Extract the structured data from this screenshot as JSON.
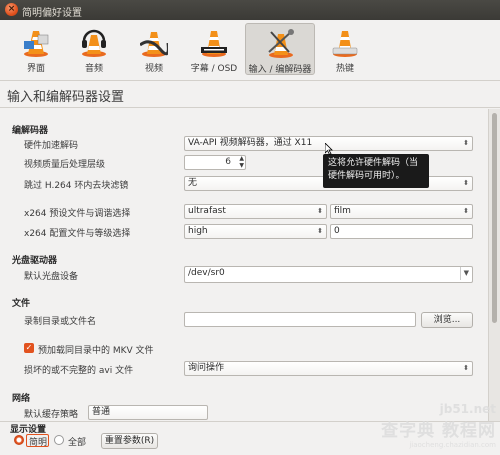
{
  "window": {
    "title": "简明偏好设置"
  },
  "toolbar": {
    "items": [
      {
        "label": "界面"
      },
      {
        "label": "音频"
      },
      {
        "label": "视频"
      },
      {
        "label": "字幕 / OSD"
      },
      {
        "label": "输入 / 编解码器"
      },
      {
        "label": "热键"
      }
    ]
  },
  "header": {
    "title": "输入和编解码器设置"
  },
  "codecs": {
    "section": "编解码器",
    "hw_label": "硬件加速解码",
    "hw_value": "VA-API 视频解码器，通过 X11",
    "pp_label": "视频质量后处理层级",
    "pp_value": "6",
    "skip_label": "跳过 H.264 环内去块滤镜",
    "skip_value": "无",
    "x264_preset_label": "x264 预设文件与调谐选择",
    "x264_preset_value": "ultrafast",
    "x264_tune_value": "film",
    "x264_profile_label": "x264 配置文件与等级选择",
    "x264_profile_value": "high",
    "x264_level_value": "0"
  },
  "tooltip": {
    "text": "这将允许硬件解码（当硬件解码可用时）。"
  },
  "optical": {
    "section": "光盘驱动器",
    "device_label": "默认光盘设备",
    "device_value": "/dev/sr0"
  },
  "files": {
    "section": "文件",
    "record_label": "录制目录或文件名",
    "record_value": "",
    "browse_label": "浏览...",
    "mkv_label": "预加载同目录中的 MKV 文件",
    "avi_label": "损坏的或不完整的 avi 文件",
    "avi_value": "询问操作"
  },
  "network": {
    "section": "网络",
    "partial_label": "默认缓存策略",
    "partial_value": "普通"
  },
  "footer": {
    "show_settings": "显示设置",
    "simple": "简明",
    "all": "全部",
    "reset": "重置参数(R)"
  },
  "watermark": {
    "line1": "jb51.net",
    "line2": "查字典 教程网",
    "line3": "jiaocheng.chazidian.com"
  },
  "colors": {
    "accent": "#e2521e",
    "titlebar": "#3b3a36"
  }
}
